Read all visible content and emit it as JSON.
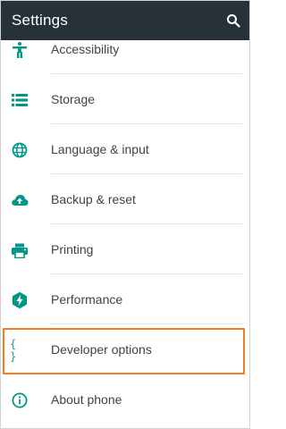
{
  "appbar": {
    "title": "Settings",
    "search_icon": "search-icon",
    "background": "#263238"
  },
  "accent_color": "#009688",
  "highlight_color": "#f57c1f",
  "items": [
    {
      "label": "Accessibility",
      "icon": "accessibility-icon"
    },
    {
      "label": "Storage",
      "icon": "storage-icon"
    },
    {
      "label": "Language & input",
      "icon": "globe-icon"
    },
    {
      "label": "Backup & reset",
      "icon": "cloud-upload-icon"
    },
    {
      "label": "Printing",
      "icon": "printer-icon"
    },
    {
      "label": "Performance",
      "icon": "performance-icon"
    },
    {
      "label": "Developer options",
      "icon": "code-braces-icon",
      "glyph": "{ }",
      "highlighted": true
    },
    {
      "label": "About phone",
      "icon": "info-icon"
    }
  ]
}
